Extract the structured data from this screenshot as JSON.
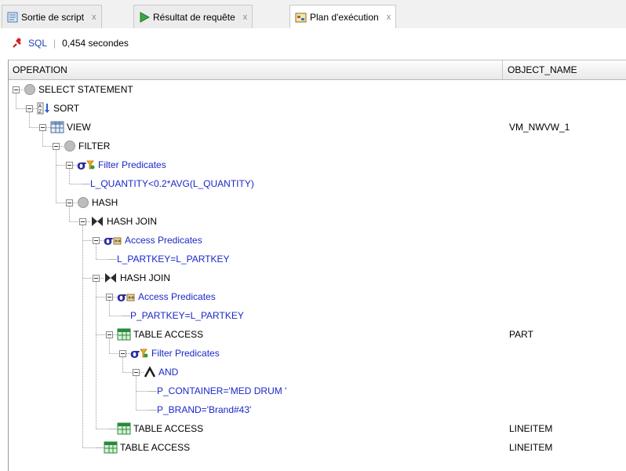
{
  "tabs": [
    {
      "label": "Sortie de script",
      "close": "x",
      "icon": "script-output-icon"
    },
    {
      "label": "Résultat de requête",
      "close": "x",
      "icon": "run-icon"
    },
    {
      "label": "Plan d'exécution",
      "close": "x",
      "icon": "explain-plan-icon",
      "active": true
    }
  ],
  "toolbar": {
    "sql_label": "SQL",
    "separator": "|",
    "time_text": "0,454 secondes",
    "pin_icon": "pin-icon"
  },
  "columns": {
    "operation": "OPERATION",
    "object_name": "OBJECT_NAME"
  },
  "plan": [
    {
      "level": 0,
      "label": "SELECT STATEMENT",
      "icon": "circle-gray-icon",
      "object": "",
      "expander": true
    },
    {
      "level": 1,
      "label": "SORT",
      "icon": "sort-icon",
      "object": "",
      "expander": true
    },
    {
      "level": 2,
      "label": "VIEW",
      "icon": "view-table-icon",
      "object": "VM_NWVW_1",
      "expander": true
    },
    {
      "level": 3,
      "label": "FILTER",
      "icon": "circle-gray-icon",
      "object": "",
      "expander": true
    },
    {
      "level": 4,
      "label": "Filter Predicates",
      "icon": "sigma-filter-icon",
      "object": "",
      "expander": true,
      "predicate": true
    },
    {
      "level": 5,
      "label": "L_QUANTITY<0.2*AVG(L_QUANTITY)",
      "icon": "",
      "object": "",
      "expander": false,
      "predicate": true
    },
    {
      "level": 4,
      "label": "HASH",
      "icon": "circle-gray-icon",
      "object": "",
      "expander": true
    },
    {
      "level": 5,
      "label": "HASH JOIN",
      "icon": "bowtie-join-icon",
      "object": "",
      "expander": true
    },
    {
      "level": 6,
      "label": "Access Predicates",
      "icon": "sigma-access-icon",
      "object": "",
      "expander": true,
      "predicate": true
    },
    {
      "level": 7,
      "label": "L_PARTKEY=L_PARTKEY",
      "icon": "",
      "object": "",
      "expander": false,
      "predicate": true
    },
    {
      "level": 6,
      "label": "HASH JOIN",
      "icon": "bowtie-join-icon",
      "object": "",
      "expander": true
    },
    {
      "level": 7,
      "label": "Access Predicates",
      "icon": "sigma-access-icon",
      "object": "",
      "expander": true,
      "predicate": true
    },
    {
      "level": 8,
      "label": "P_PARTKEY=L_PARTKEY",
      "icon": "",
      "object": "",
      "expander": false,
      "predicate": true
    },
    {
      "level": 7,
      "label": "TABLE ACCESS",
      "icon": "table-green-icon",
      "object": "PART",
      "expander": true
    },
    {
      "level": 8,
      "label": "Filter Predicates",
      "icon": "sigma-filter-icon",
      "object": "",
      "expander": true,
      "predicate": true
    },
    {
      "level": 9,
      "label": "AND",
      "icon": "and-caret-icon",
      "object": "",
      "expander": true,
      "predicate": true
    },
    {
      "level": 10,
      "label": "P_CONTAINER='MED DRUM '",
      "icon": "",
      "object": "",
      "expander": false,
      "predicate": true
    },
    {
      "level": 10,
      "label": "P_BRAND='Brand#43'",
      "icon": "",
      "object": "",
      "expander": false,
      "predicate": true
    },
    {
      "level": 7,
      "label": "TABLE ACCESS",
      "icon": "table-green-icon",
      "object": "LINEITEM",
      "expander": false
    },
    {
      "level": 6,
      "label": "TABLE ACCESS",
      "icon": "table-green-icon",
      "object": "LINEITEM",
      "expander": false
    }
  ],
  "colors": {
    "predicate": "#1a28c8",
    "table_icon": "#2a8a3a",
    "join_icon": "#2c2c2c",
    "sigma": "#2a2aa0"
  }
}
